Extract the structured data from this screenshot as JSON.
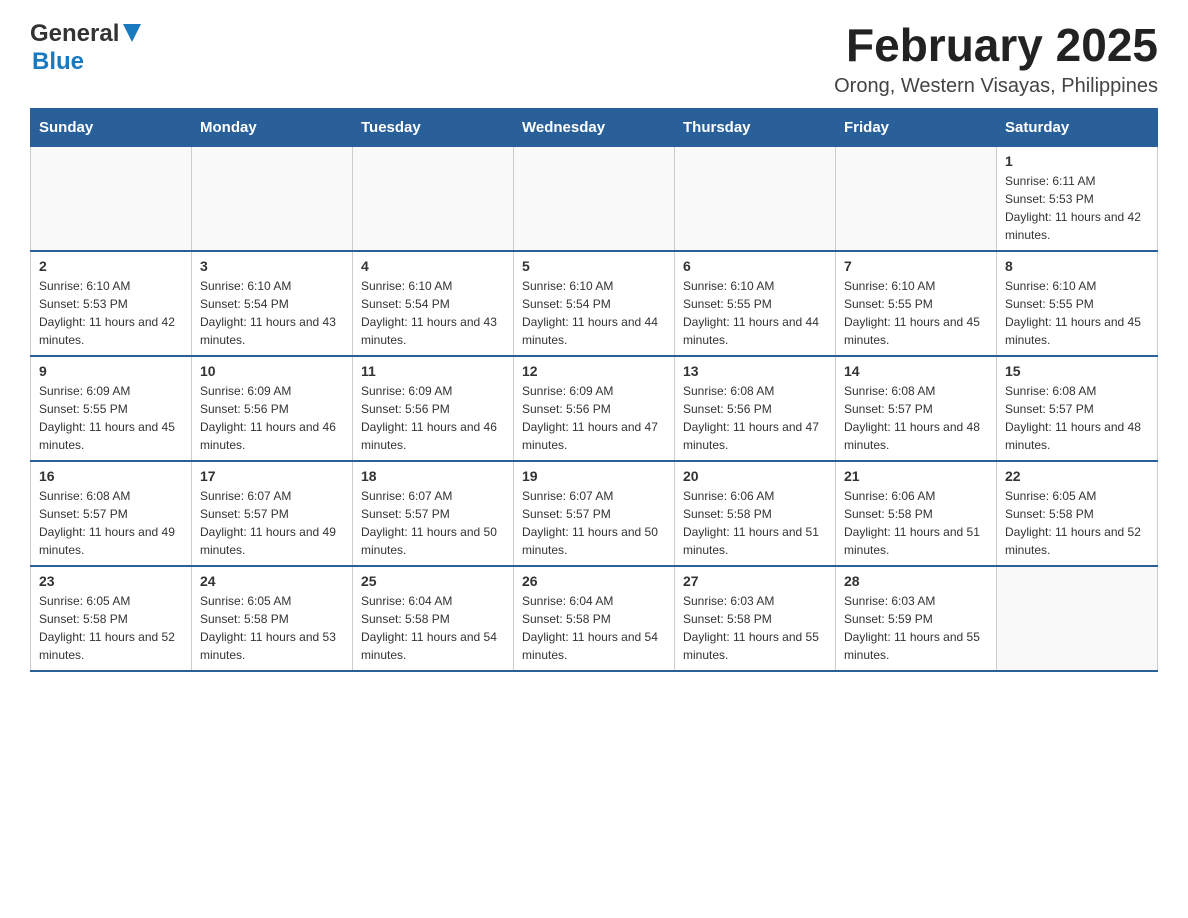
{
  "header": {
    "logo_general": "General",
    "logo_blue": "Blue",
    "title": "February 2025",
    "subtitle": "Orong, Western Visayas, Philippines"
  },
  "weekdays": [
    "Sunday",
    "Monday",
    "Tuesday",
    "Wednesday",
    "Thursday",
    "Friday",
    "Saturday"
  ],
  "weeks": [
    [
      {
        "day": "",
        "sunrise": "",
        "sunset": "",
        "daylight": ""
      },
      {
        "day": "",
        "sunrise": "",
        "sunset": "",
        "daylight": ""
      },
      {
        "day": "",
        "sunrise": "",
        "sunset": "",
        "daylight": ""
      },
      {
        "day": "",
        "sunrise": "",
        "sunset": "",
        "daylight": ""
      },
      {
        "day": "",
        "sunrise": "",
        "sunset": "",
        "daylight": ""
      },
      {
        "day": "",
        "sunrise": "",
        "sunset": "",
        "daylight": ""
      },
      {
        "day": "1",
        "sunrise": "Sunrise: 6:11 AM",
        "sunset": "Sunset: 5:53 PM",
        "daylight": "Daylight: 11 hours and 42 minutes."
      }
    ],
    [
      {
        "day": "2",
        "sunrise": "Sunrise: 6:10 AM",
        "sunset": "Sunset: 5:53 PM",
        "daylight": "Daylight: 11 hours and 42 minutes."
      },
      {
        "day": "3",
        "sunrise": "Sunrise: 6:10 AM",
        "sunset": "Sunset: 5:54 PM",
        "daylight": "Daylight: 11 hours and 43 minutes."
      },
      {
        "day": "4",
        "sunrise": "Sunrise: 6:10 AM",
        "sunset": "Sunset: 5:54 PM",
        "daylight": "Daylight: 11 hours and 43 minutes."
      },
      {
        "day": "5",
        "sunrise": "Sunrise: 6:10 AM",
        "sunset": "Sunset: 5:54 PM",
        "daylight": "Daylight: 11 hours and 44 minutes."
      },
      {
        "day": "6",
        "sunrise": "Sunrise: 6:10 AM",
        "sunset": "Sunset: 5:55 PM",
        "daylight": "Daylight: 11 hours and 44 minutes."
      },
      {
        "day": "7",
        "sunrise": "Sunrise: 6:10 AM",
        "sunset": "Sunset: 5:55 PM",
        "daylight": "Daylight: 11 hours and 45 minutes."
      },
      {
        "day": "8",
        "sunrise": "Sunrise: 6:10 AM",
        "sunset": "Sunset: 5:55 PM",
        "daylight": "Daylight: 11 hours and 45 minutes."
      }
    ],
    [
      {
        "day": "9",
        "sunrise": "Sunrise: 6:09 AM",
        "sunset": "Sunset: 5:55 PM",
        "daylight": "Daylight: 11 hours and 45 minutes."
      },
      {
        "day": "10",
        "sunrise": "Sunrise: 6:09 AM",
        "sunset": "Sunset: 5:56 PM",
        "daylight": "Daylight: 11 hours and 46 minutes."
      },
      {
        "day": "11",
        "sunrise": "Sunrise: 6:09 AM",
        "sunset": "Sunset: 5:56 PM",
        "daylight": "Daylight: 11 hours and 46 minutes."
      },
      {
        "day": "12",
        "sunrise": "Sunrise: 6:09 AM",
        "sunset": "Sunset: 5:56 PM",
        "daylight": "Daylight: 11 hours and 47 minutes."
      },
      {
        "day": "13",
        "sunrise": "Sunrise: 6:08 AM",
        "sunset": "Sunset: 5:56 PM",
        "daylight": "Daylight: 11 hours and 47 minutes."
      },
      {
        "day": "14",
        "sunrise": "Sunrise: 6:08 AM",
        "sunset": "Sunset: 5:57 PM",
        "daylight": "Daylight: 11 hours and 48 minutes."
      },
      {
        "day": "15",
        "sunrise": "Sunrise: 6:08 AM",
        "sunset": "Sunset: 5:57 PM",
        "daylight": "Daylight: 11 hours and 48 minutes."
      }
    ],
    [
      {
        "day": "16",
        "sunrise": "Sunrise: 6:08 AM",
        "sunset": "Sunset: 5:57 PM",
        "daylight": "Daylight: 11 hours and 49 minutes."
      },
      {
        "day": "17",
        "sunrise": "Sunrise: 6:07 AM",
        "sunset": "Sunset: 5:57 PM",
        "daylight": "Daylight: 11 hours and 49 minutes."
      },
      {
        "day": "18",
        "sunrise": "Sunrise: 6:07 AM",
        "sunset": "Sunset: 5:57 PM",
        "daylight": "Daylight: 11 hours and 50 minutes."
      },
      {
        "day": "19",
        "sunrise": "Sunrise: 6:07 AM",
        "sunset": "Sunset: 5:57 PM",
        "daylight": "Daylight: 11 hours and 50 minutes."
      },
      {
        "day": "20",
        "sunrise": "Sunrise: 6:06 AM",
        "sunset": "Sunset: 5:58 PM",
        "daylight": "Daylight: 11 hours and 51 minutes."
      },
      {
        "day": "21",
        "sunrise": "Sunrise: 6:06 AM",
        "sunset": "Sunset: 5:58 PM",
        "daylight": "Daylight: 11 hours and 51 minutes."
      },
      {
        "day": "22",
        "sunrise": "Sunrise: 6:05 AM",
        "sunset": "Sunset: 5:58 PM",
        "daylight": "Daylight: 11 hours and 52 minutes."
      }
    ],
    [
      {
        "day": "23",
        "sunrise": "Sunrise: 6:05 AM",
        "sunset": "Sunset: 5:58 PM",
        "daylight": "Daylight: 11 hours and 52 minutes."
      },
      {
        "day": "24",
        "sunrise": "Sunrise: 6:05 AM",
        "sunset": "Sunset: 5:58 PM",
        "daylight": "Daylight: 11 hours and 53 minutes."
      },
      {
        "day": "25",
        "sunrise": "Sunrise: 6:04 AM",
        "sunset": "Sunset: 5:58 PM",
        "daylight": "Daylight: 11 hours and 54 minutes."
      },
      {
        "day": "26",
        "sunrise": "Sunrise: 6:04 AM",
        "sunset": "Sunset: 5:58 PM",
        "daylight": "Daylight: 11 hours and 54 minutes."
      },
      {
        "day": "27",
        "sunrise": "Sunrise: 6:03 AM",
        "sunset": "Sunset: 5:58 PM",
        "daylight": "Daylight: 11 hours and 55 minutes."
      },
      {
        "day": "28",
        "sunrise": "Sunrise: 6:03 AM",
        "sunset": "Sunset: 5:59 PM",
        "daylight": "Daylight: 11 hours and 55 minutes."
      },
      {
        "day": "",
        "sunrise": "",
        "sunset": "",
        "daylight": ""
      }
    ]
  ]
}
